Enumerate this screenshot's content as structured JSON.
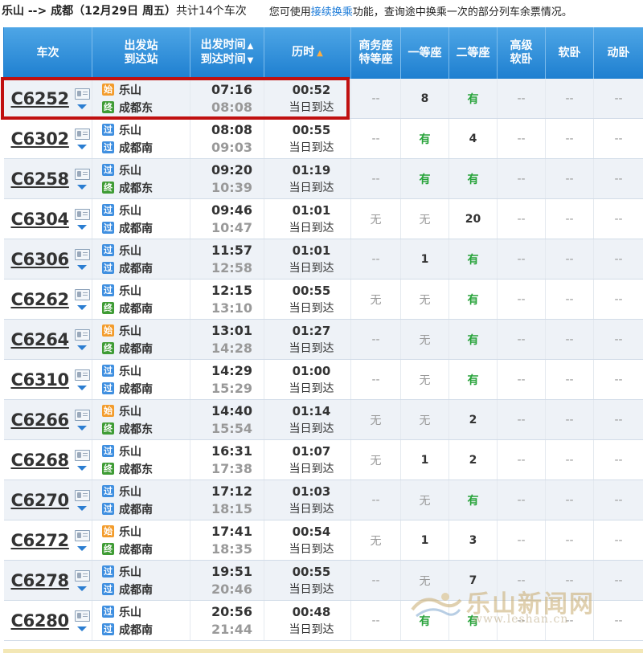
{
  "header": {
    "route": "乐山 --> 成都（12月29日  周五）",
    "count": "共计14个车次",
    "tip_prefix": "您可使用",
    "tip_link": "接续换乘",
    "tip_suffix": "功能，查询途中换乘一次的部分列车余票情况。"
  },
  "columns": {
    "train_no": "车次",
    "station_line1": "出发站",
    "station_line2": "到达站",
    "time_line1": "出发时间",
    "time_line2": "到达时间",
    "duration": "历时",
    "business_line1": "商务座",
    "business_line2": "特等座",
    "first": "一等座",
    "second": "二等座",
    "senior_line1": "高级",
    "senior_line2": "软卧",
    "soft_sleeper": "软卧",
    "moving_sleeper": "动卧"
  },
  "icons": {
    "start": "始",
    "pass": "过",
    "end": "终"
  },
  "trains": [
    {
      "no": "C6252",
      "from_badge": "始",
      "from": "乐山",
      "to_badge": "终",
      "to": "成都东",
      "dep": "07:16",
      "arr": "08:08",
      "dur": "00:52",
      "note": "当日到达",
      "business": "--",
      "first": "8",
      "second": "有",
      "senior": "--",
      "soft": "--",
      "moving": "--"
    },
    {
      "no": "C6302",
      "from_badge": "过",
      "from": "乐山",
      "to_badge": "过",
      "to": "成都南",
      "dep": "08:08",
      "arr": "09:03",
      "dur": "00:55",
      "note": "当日到达",
      "business": "--",
      "first": "有",
      "second": "4",
      "senior": "--",
      "soft": "--",
      "moving": "--"
    },
    {
      "no": "C6258",
      "from_badge": "过",
      "from": "乐山",
      "to_badge": "终",
      "to": "成都东",
      "dep": "09:20",
      "arr": "10:39",
      "dur": "01:19",
      "note": "当日到达",
      "business": "--",
      "first": "有",
      "second": "有",
      "senior": "--",
      "soft": "--",
      "moving": "--"
    },
    {
      "no": "C6304",
      "from_badge": "过",
      "from": "乐山",
      "to_badge": "过",
      "to": "成都南",
      "dep": "09:46",
      "arr": "10:47",
      "dur": "01:01",
      "note": "当日到达",
      "business": "无",
      "first": "无",
      "second": "20",
      "senior": "--",
      "soft": "--",
      "moving": "--"
    },
    {
      "no": "C6306",
      "from_badge": "过",
      "from": "乐山",
      "to_badge": "过",
      "to": "成都南",
      "dep": "11:57",
      "arr": "12:58",
      "dur": "01:01",
      "note": "当日到达",
      "business": "--",
      "first": "1",
      "second": "有",
      "senior": "--",
      "soft": "--",
      "moving": "--"
    },
    {
      "no": "C6262",
      "from_badge": "过",
      "from": "乐山",
      "to_badge": "终",
      "to": "成都南",
      "dep": "12:15",
      "arr": "13:10",
      "dur": "00:55",
      "note": "当日到达",
      "business": "无",
      "first": "无",
      "second": "有",
      "senior": "--",
      "soft": "--",
      "moving": "--"
    },
    {
      "no": "C6264",
      "from_badge": "始",
      "from": "乐山",
      "to_badge": "终",
      "to": "成都南",
      "dep": "13:01",
      "arr": "14:28",
      "dur": "01:27",
      "note": "当日到达",
      "business": "--",
      "first": "无",
      "second": "有",
      "senior": "--",
      "soft": "--",
      "moving": "--"
    },
    {
      "no": "C6310",
      "from_badge": "过",
      "from": "乐山",
      "to_badge": "过",
      "to": "成都南",
      "dep": "14:29",
      "arr": "15:29",
      "dur": "01:00",
      "note": "当日到达",
      "business": "--",
      "first": "无",
      "second": "有",
      "senior": "--",
      "soft": "--",
      "moving": "--"
    },
    {
      "no": "C6266",
      "from_badge": "始",
      "from": "乐山",
      "to_badge": "终",
      "to": "成都东",
      "dep": "14:40",
      "arr": "15:54",
      "dur": "01:14",
      "note": "当日到达",
      "business": "无",
      "first": "无",
      "second": "2",
      "senior": "--",
      "soft": "--",
      "moving": "--"
    },
    {
      "no": "C6268",
      "from_badge": "过",
      "from": "乐山",
      "to_badge": "终",
      "to": "成都东",
      "dep": "16:31",
      "arr": "17:38",
      "dur": "01:07",
      "note": "当日到达",
      "business": "无",
      "first": "1",
      "second": "2",
      "senior": "--",
      "soft": "--",
      "moving": "--"
    },
    {
      "no": "C6270",
      "from_badge": "过",
      "from": "乐山",
      "to_badge": "过",
      "to": "成都南",
      "dep": "17:12",
      "arr": "18:15",
      "dur": "01:03",
      "note": "当日到达",
      "business": "--",
      "first": "无",
      "second": "有",
      "senior": "--",
      "soft": "--",
      "moving": "--"
    },
    {
      "no": "C6272",
      "from_badge": "始",
      "from": "乐山",
      "to_badge": "终",
      "to": "成都南",
      "dep": "17:41",
      "arr": "18:35",
      "dur": "00:54",
      "note": "当日到达",
      "business": "无",
      "first": "1",
      "second": "3",
      "senior": "--",
      "soft": "--",
      "moving": "--"
    },
    {
      "no": "C6278",
      "from_badge": "过",
      "from": "乐山",
      "to_badge": "过",
      "to": "成都南",
      "dep": "19:51",
      "arr": "20:46",
      "dur": "00:55",
      "note": "当日到达",
      "business": "--",
      "first": "无",
      "second": "7",
      "senior": "--",
      "soft": "--",
      "moving": "--"
    },
    {
      "no": "C6280",
      "from_badge": "过",
      "from": "乐山",
      "to_badge": "过",
      "to": "成都南",
      "dep": "20:56",
      "arr": "21:44",
      "dur": "00:48",
      "note": "当日到达",
      "business": "--",
      "first": "有",
      "second": "有",
      "senior": "--",
      "soft": "--",
      "moving": "--"
    }
  ],
  "watermark": {
    "cn": "乐山新闻网",
    "url": "www.leshan.cn"
  },
  "colors": {
    "header_blue": "#1e7fd0",
    "available_green": "#27a33a",
    "highlight_red": "#c01010",
    "link_blue": "#1a7ad8"
  }
}
